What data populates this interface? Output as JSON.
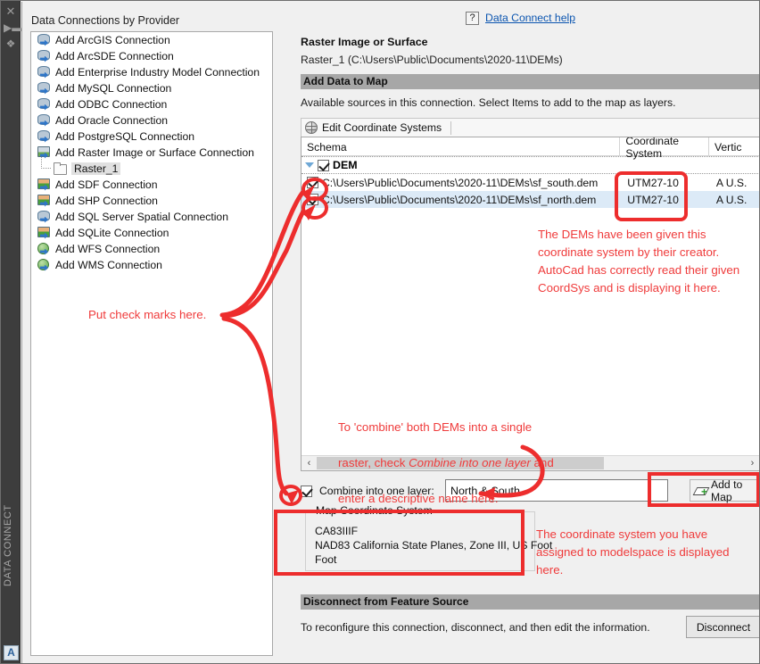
{
  "dock": {
    "label": "DATA CONNECT",
    "close_icon": "close-icon",
    "pin_icon": "auto-hide-pin-icon",
    "gear_icon": "properties-gear-icon",
    "logo_text": "A"
  },
  "tree": {
    "title": "Data Connections by Provider",
    "items": [
      {
        "label": "Add ArcGIS Connection",
        "icon": "database-connection-icon",
        "type": "db",
        "child": false
      },
      {
        "label": "Add ArcSDE Connection",
        "icon": "database-connection-icon",
        "type": "db",
        "child": false
      },
      {
        "label": "Add Enterprise Industry Model Connection",
        "icon": "database-connection-icon",
        "type": "db",
        "child": false
      },
      {
        "label": "Add MySQL Connection",
        "icon": "database-connection-icon",
        "type": "db",
        "child": false
      },
      {
        "label": "Add ODBC Connection",
        "icon": "database-connection-icon",
        "type": "db",
        "child": false
      },
      {
        "label": "Add Oracle Connection",
        "icon": "database-connection-icon",
        "type": "db",
        "child": false
      },
      {
        "label": "Add PostgreSQL Connection",
        "icon": "database-connection-icon",
        "type": "db",
        "child": false
      },
      {
        "label": "Add Raster Image or Surface Connection",
        "icon": "raster-connection-icon",
        "type": "raster",
        "child": false
      },
      {
        "label": "Raster_1",
        "icon": "folder-icon",
        "type": "folder",
        "child": true,
        "selected": true
      },
      {
        "label": "Add SDF Connection",
        "icon": "sdf-connection-icon",
        "type": "rasterg",
        "child": false
      },
      {
        "label": "Add SHP Connection",
        "icon": "shp-connection-icon",
        "type": "rasterg",
        "child": false
      },
      {
        "label": "Add SQL Server Spatial Connection",
        "icon": "database-connection-icon",
        "type": "db",
        "child": false
      },
      {
        "label": "Add SQLite Connection",
        "icon": "sqlite-connection-icon",
        "type": "rasterg",
        "child": false
      },
      {
        "label": "Add WFS Connection",
        "icon": "globe-connection-icon",
        "type": "globe",
        "child": false
      },
      {
        "label": "Add WMS Connection",
        "icon": "globe-connection-icon",
        "type": "globe",
        "child": false
      }
    ]
  },
  "help": {
    "qmark": "?",
    "link": "Data Connect help"
  },
  "connection": {
    "title": "Raster Image or Surface",
    "subtitle": "Raster_1 (C:\\Users\\Public\\Documents\\2020-11\\DEMs)"
  },
  "add_data": {
    "bar_title": "Add Data to Map",
    "instruction": "Available sources in this connection.  Select Items to add to the map as layers.",
    "toolbar": {
      "edit_cs_label": "Edit Coordinate Systems"
    }
  },
  "grid": {
    "columns": [
      "Schema",
      "Coordinate System",
      "Vertic"
    ],
    "group": {
      "label": "DEM",
      "checked": true,
      "expanded": true
    },
    "rows": [
      {
        "checked": true,
        "schema": "C:\\Users\\Public\\Documents\\2020-11\\DEMs\\sf_south.dem",
        "coordinate_system": "UTM27-10",
        "vertical": "A U.S."
      },
      {
        "checked": true,
        "schema": "C:\\Users\\Public\\Documents\\2020-11\\DEMs\\sf_north.dem",
        "coordinate_system": "UTM27-10",
        "vertical": "A U.S."
      }
    ],
    "hscroll": {
      "left_arrow": "‹",
      "right_arrow": "›"
    }
  },
  "combine": {
    "checked": true,
    "label": "Combine into one layer:",
    "value": "North & South",
    "placeholder": "",
    "add_to_map_label": "Add to Map"
  },
  "map_coordinate_system": {
    "legend": "Map Coordinate System",
    "code": "CA83IIIF",
    "description": "NAD83 California State Planes, Zone III, US Foot",
    "units": "Foot"
  },
  "disconnect": {
    "bar_title": "Disconnect from Feature Source",
    "text": "To reconfigure this connection, disconnect, and then edit the information.",
    "button_label": "Disconnect"
  },
  "annotations": {
    "color": "#ef3b3b",
    "coordinate_system": "The DEMs have been given this coordinate system by their creator. AutoCad has correctly read their given CoordSys and is displaying it here.",
    "combine_line1": "To 'combine' both DEMs into a single",
    "combine_line2a": "raster, check ",
    "combine_line2b": "Combine into one layer",
    "combine_line2c": " and",
    "combine_line3": "enter a descriptive name here.",
    "map_coordinate_system": "The coordinate system you have assigned to modelspace is displayed here.",
    "checkmarks": "Put check marks here."
  }
}
